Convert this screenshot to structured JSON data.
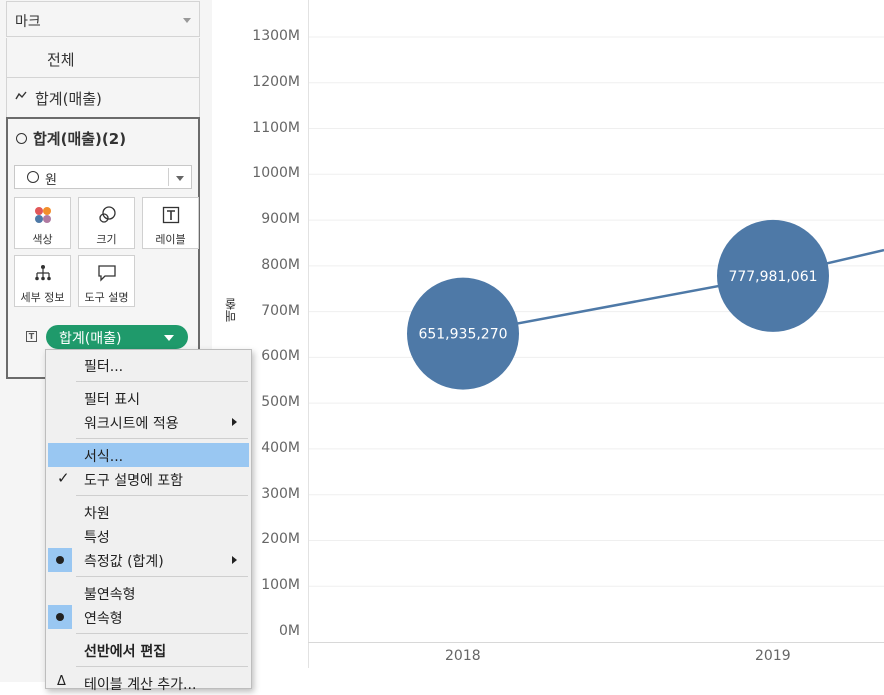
{
  "marks_card": {
    "dropdown_label": "마크",
    "all_label": "전체",
    "line_measure_label": "합계(매출)",
    "selected_measure_label": "합계(매출)(2)",
    "mark_type": "원",
    "buttons": {
      "color": "색상",
      "size": "크기",
      "label": "레이블",
      "detail": "세부 정보",
      "tooltip": "도구 설명"
    },
    "pill_label": "합계(매출)"
  },
  "context_menu": {
    "items": {
      "filter": "필터...",
      "show_filter": "필터 표시",
      "apply_worksheets": "워크시트에 적용",
      "format": "서식...",
      "include_tooltip": "도구 설명에 포함",
      "dimension": "차원",
      "attribute": "특성",
      "measure_sum": "측정값 (합계)",
      "discrete": "불연속형",
      "continuous": "연속형",
      "edit_in_shelf": "선반에서 편집",
      "add_table_calc": "테이블 계산 추가..."
    }
  },
  "chart_data": {
    "type": "line",
    "ylabel": "매출",
    "yticks": [
      "0M",
      "100M",
      "200M",
      "300M",
      "400M",
      "500M",
      "600M",
      "700M",
      "800M",
      "900M",
      "1000M",
      "1100M",
      "1200M",
      "1300M"
    ],
    "ylim": [
      0,
      1300000000
    ],
    "categories": [
      "2018",
      "2019"
    ],
    "series": [
      {
        "values": [
          651935270,
          777981061
        ]
      }
    ],
    "data_labels": [
      "651,935,270",
      "777,981,061"
    ],
    "color": "#4e79a7",
    "grid": true
  }
}
